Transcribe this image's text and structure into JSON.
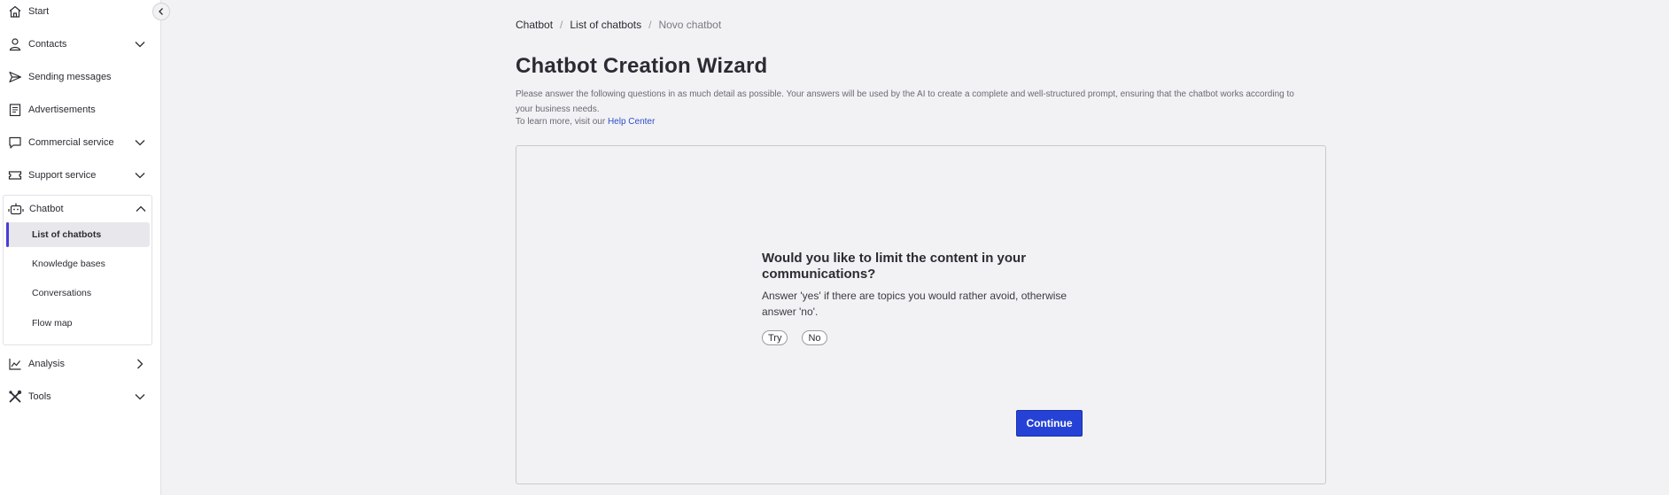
{
  "sidebar": {
    "items": [
      {
        "label": "Start",
        "icon": "home-icon"
      },
      {
        "label": "Contacts",
        "icon": "person-icon"
      },
      {
        "label": "Sending messages",
        "icon": "send-icon"
      },
      {
        "label": "Advertisements",
        "icon": "document-icon"
      },
      {
        "label": "Commercial service",
        "icon": "chat-icon"
      },
      {
        "label": "Support service",
        "icon": "ticket-icon"
      },
      {
        "label": "Chatbot",
        "icon": "robot-icon"
      },
      {
        "label": "Analysis",
        "icon": "chart-icon"
      },
      {
        "label": "Tools",
        "icon": "tools-icon"
      }
    ],
    "chatbot_sub": [
      {
        "label": "List of chatbots",
        "active": true
      },
      {
        "label": "Knowledge bases"
      },
      {
        "label": "Conversations"
      },
      {
        "label": "Flow map"
      }
    ]
  },
  "breadcrumb": {
    "items": [
      "Chatbot",
      "List of chatbots",
      "Novo chatbot"
    ],
    "separator": "/"
  },
  "page": {
    "title": "Chatbot Creation Wizard",
    "description": "Please answer the following questions in as much detail as possible. Your answers will be used by the AI to create a complete and well-structured prompt, ensuring that the chatbot works according to your business needs.",
    "help_prefix": "To learn more, visit our",
    "help_link": "Help Center"
  },
  "wizard": {
    "question": "Would you like to limit the content in your communications?",
    "hint": "Answer 'yes' if there are topics you would rather avoid, otherwise answer 'no'.",
    "options": [
      "Try",
      "No"
    ],
    "continue_label": "Continue"
  },
  "colors": {
    "accent": "#2642d6",
    "active_indicator": "#4a3cd6",
    "link": "#2c4ec8",
    "background": "#f2f2f4"
  }
}
